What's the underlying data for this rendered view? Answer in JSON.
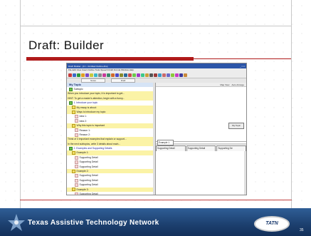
{
  "slide": {
    "title": "Draft: Builder",
    "footer_org": "Texas Assistive Technology Network",
    "logo_text": "TATN",
    "page_number": "35"
  },
  "app": {
    "window_title": "Draft: Builder - [C:\\...\\Untitled Outline.dbo]",
    "menu": "File  Edit  View  Insert  Outline  Tools  Speech  Draft  Format  Window  Help",
    "tabs": [
      "Notes",
      "Draft"
    ],
    "tree_header": "My Topic",
    "tree": [
      {
        "text": "Subtopic",
        "mark": "g",
        "indent": 3,
        "hl": false,
        "blue": false
      },
      {
        "text": "When you introduce your topic, it is important to get...",
        "mark": "",
        "indent": 1,
        "hl": true,
        "blue": false
      },
      {
        "text": "HINT: To get a reader's attention, begin with a funny...",
        "mark": "",
        "indent": 1,
        "hl": true,
        "blue": false
      },
      {
        "text": "1. Introduce your topic",
        "mark": "g",
        "indent": 3,
        "hl": false,
        "blue": true
      },
      {
        "text": "My essay is about:",
        "mark": "y",
        "indent": 7,
        "hl": true,
        "blue": false
      },
      {
        "text": "Ways to introduce my topic:",
        "mark": "y",
        "indent": 7,
        "hl": true,
        "blue": false
      },
      {
        "text": "Idea 1:",
        "mark": "p",
        "indent": 11,
        "hl": false,
        "blue": false
      },
      {
        "text": "Idea 2:",
        "mark": "p",
        "indent": 11,
        "hl": false,
        "blue": false
      },
      {
        "text": "Why this topic is important",
        "mark": "y",
        "indent": 7,
        "hl": true,
        "blue": false
      },
      {
        "text": "Reason 1:",
        "mark": "p",
        "indent": 11,
        "hl": false,
        "blue": false
      },
      {
        "text": "Reason 2:",
        "mark": "p",
        "indent": 11,
        "hl": false,
        "blue": false
      },
      {
        "text": "Think of 3 important examples that explain or support...",
        "mark": "",
        "indent": 1,
        "hl": true,
        "blue": false
      },
      {
        "text": "In the next subtopics, write 3 details about each...",
        "mark": "",
        "indent": 1,
        "hl": true,
        "blue": false
      },
      {
        "text": "2. Examples and Supporting Details",
        "mark": "g",
        "indent": 3,
        "hl": false,
        "blue": true
      },
      {
        "text": "Example 1:",
        "mark": "y",
        "indent": 7,
        "hl": true,
        "blue": false
      },
      {
        "text": "Supporting Detail",
        "mark": "p",
        "indent": 11,
        "hl": false,
        "blue": false
      },
      {
        "text": "Supporting Detail",
        "mark": "p",
        "indent": 11,
        "hl": false,
        "blue": false
      },
      {
        "text": "Supporting Detail",
        "mark": "p",
        "indent": 11,
        "hl": false,
        "blue": false
      },
      {
        "text": "Example 2:",
        "mark": "y",
        "indent": 7,
        "hl": true,
        "blue": false
      },
      {
        "text": "Supporting Detail",
        "mark": "p",
        "indent": 11,
        "hl": false,
        "blue": false
      },
      {
        "text": "Supporting Detail",
        "mark": "p",
        "indent": 11,
        "hl": false,
        "blue": false
      },
      {
        "text": "Supporting Detail",
        "mark": "p",
        "indent": 11,
        "hl": false,
        "blue": false
      },
      {
        "text": "Example 3:",
        "mark": "y",
        "indent": 7,
        "hl": true,
        "blue": false
      },
      {
        "text": "Supporting Detail",
        "mark": "p",
        "indent": 11,
        "hl": false,
        "blue": false
      }
    ],
    "right_top_items": [
      "Map View",
      "Auto Arrange"
    ],
    "map_button": "My Topic",
    "example_box": "Example 1",
    "supporting_cells": [
      "Supporting Detail",
      "Supporting Detail",
      "Supporting De"
    ]
  }
}
